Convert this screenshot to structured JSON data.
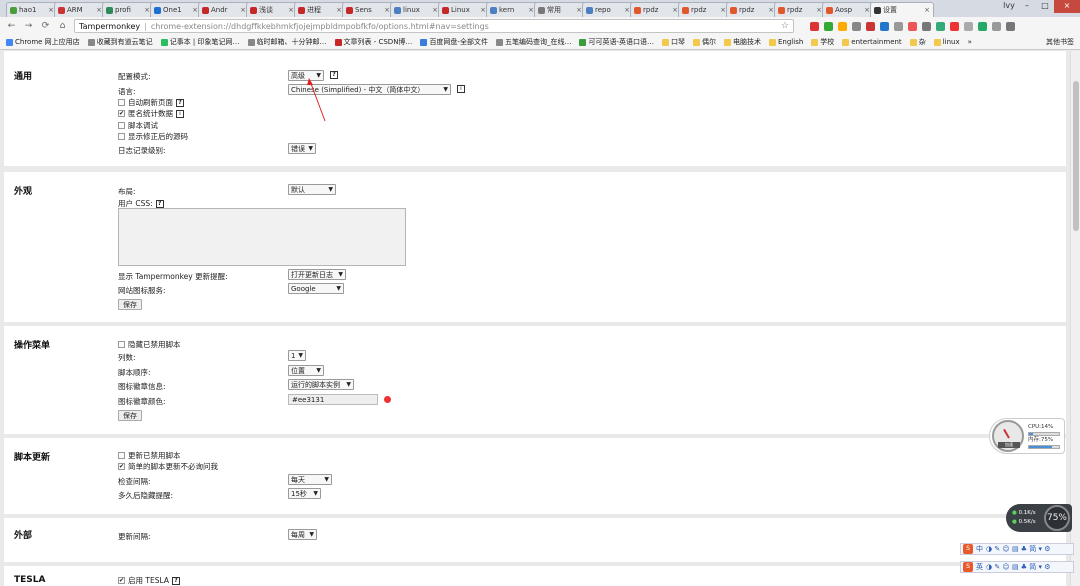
{
  "browser": {
    "tabs": [
      {
        "title": "hao1",
        "color": "#4a9d3b"
      },
      {
        "title": "ARM",
        "color": "#cc3333"
      },
      {
        "title": "profi",
        "color": "#2e8b57"
      },
      {
        "title": "One1",
        "color": "#1d6fd1"
      },
      {
        "title": "Andr",
        "color": "#c62828"
      },
      {
        "title": "浅谈",
        "color": "#c62828"
      },
      {
        "title": "进程",
        "color": "#c62828"
      },
      {
        "title": "Sens",
        "color": "#c62828"
      },
      {
        "title": "linux",
        "color": "#4a7fc1"
      },
      {
        "title": "Linux",
        "color": "#c62828"
      },
      {
        "title": "kern",
        "color": "#4a7fc1"
      },
      {
        "title": "常用",
        "color": "#777777"
      },
      {
        "title": "repo",
        "color": "#4a7fc1"
      },
      {
        "title": "rpdz",
        "color": "#e2572c"
      },
      {
        "title": "rpdz",
        "color": "#e2572c"
      },
      {
        "title": "rpdz",
        "color": "#e2572c"
      },
      {
        "title": "rpdz",
        "color": "#e2572c"
      },
      {
        "title": "Aosp",
        "color": "#e2572c"
      },
      {
        "title": "设置",
        "color": "#333333",
        "active": true
      }
    ],
    "close_glyph": "×",
    "window_controls": {
      "minimize": "–",
      "maximize": "□",
      "close": "×",
      "user": "lvy"
    },
    "nav": {
      "back": "←",
      "forward": "→",
      "reload": "⟳",
      "home": "⌂"
    },
    "omnibox": {
      "origin": "Tampermonkey",
      "separator": "|",
      "url": "chrome-extension://dhdgffkkebhmkfjojejmpbldmpobfkfo/options.html#nav=settings",
      "star": "☆"
    },
    "extension_colors": [
      "#d33",
      "#3a3",
      "#fa0",
      "#888",
      "#c33",
      "#27c",
      "#999",
      "#e55",
      "#777",
      "#3a7",
      "#e33",
      "#aaa",
      "#2a6",
      "#999",
      "#777"
    ],
    "bookmarks": [
      {
        "label": "Chrome 网上应用店",
        "color": "#4285f4"
      },
      {
        "label": "收藏到有道云笔记",
        "color": "#888888"
      },
      {
        "label": "记事本 | 印象笔记网…",
        "color": "#2dbe60"
      },
      {
        "label": "临时邮箱、十分钟邮…",
        "color": "#888888"
      },
      {
        "label": "文章列表 - CSDN博…",
        "color": "#c62828"
      },
      {
        "label": "百度网盘-全部文件",
        "color": "#3b7bdb"
      },
      {
        "label": "五笔编码查询_在线…",
        "color": "#888888"
      },
      {
        "label": "可可英语-英语口语…",
        "color": "#3a9d3a"
      },
      {
        "label": "口琴",
        "color": "#f2c94c"
      },
      {
        "label": "偶尔",
        "color": "#f2c94c"
      },
      {
        "label": "电脑技术",
        "color": "#f2c94c"
      },
      {
        "label": "English",
        "color": "#f2c94c"
      },
      {
        "label": "学校",
        "color": "#f2c94c"
      },
      {
        "label": "entertainment",
        "color": "#f2c94c"
      },
      {
        "label": "杂",
        "color": "#f2c94c"
      },
      {
        "label": "linux",
        "color": "#f2c94c"
      }
    ],
    "bookmarks_more": "»",
    "other_bookmarks": "其他书签"
  },
  "settings": {
    "general": {
      "title": "通用",
      "config_mode_label": "配置模式:",
      "config_mode_value": "高级",
      "language_label": "语言:",
      "language_value": "Chinese (Simplified) - 中文（简体中文）",
      "auto_refresh_label": "自动刷新页面",
      "anon_stats_label": "匿名统计数据",
      "script_debug_label": "脚本调试",
      "show_fixed_src_label": "显示修正后的源码",
      "log_level_label": "日志记录级别:",
      "log_level_value": "错误"
    },
    "appearance": {
      "title": "外观",
      "layout_label": "布局:",
      "layout_value": "默认",
      "user_css_label": "用户 CSS:",
      "show_update_label": "显示 Tampermonkey 更新提醒:",
      "show_update_value": "打开更新日志",
      "favicon_service_label": "网站图标服务:",
      "favicon_service_value": "Google",
      "save_label": "保存"
    },
    "action_menu": {
      "title": "操作菜单",
      "hide_disabled_label": "隐藏已禁用脚本",
      "columns_label": "列数:",
      "columns_value": "1",
      "script_order_label": "脚本顺序:",
      "script_order_value": "位置",
      "badge_info_label": "图标徽章信息:",
      "badge_info_value": "运行的脚本实例",
      "badge_color_label": "图标徽章颜色:",
      "badge_color_value": "#ee3131",
      "badge_color": "#ee3131",
      "save_label": "保存"
    },
    "script_update": {
      "title": "脚本更新",
      "update_disabled_label": "更新已禁用脚本",
      "simple_no_ask_label": "简单的脚本更新不必询问我",
      "check_interval_label": "检查间隔:",
      "check_interval_value": "每天",
      "hide_notify_label": "多久后隐藏提醒:",
      "hide_notify_value": "15秒"
    },
    "external": {
      "title": "外部",
      "update_interval_label": "更新间隔:",
      "update_interval_value": "每周"
    },
    "tesla": {
      "title": "TESLA",
      "enable_label": "启用 TESLA"
    },
    "help_glyph": "?",
    "info_glyph": "i",
    "check_glyph": "✔",
    "arrow_glyph": "▼"
  },
  "overlays": {
    "perf": {
      "cpu_label": "CPU:14%",
      "cpu": 0.14,
      "mem_label": "内存:75%",
      "mem": 0.75,
      "gauge_label": "加速"
    },
    "net": {
      "up": "0.1K/s",
      "down": "0.5K/s",
      "percent": "75%"
    },
    "ime": {
      "logo": "S",
      "bars": [
        {
          "mode": "中"
        },
        {
          "mode": "英"
        }
      ],
      "icons": "◑ ✎ ☺ ▤ ♣ 简 ▾ ⚙"
    }
  }
}
